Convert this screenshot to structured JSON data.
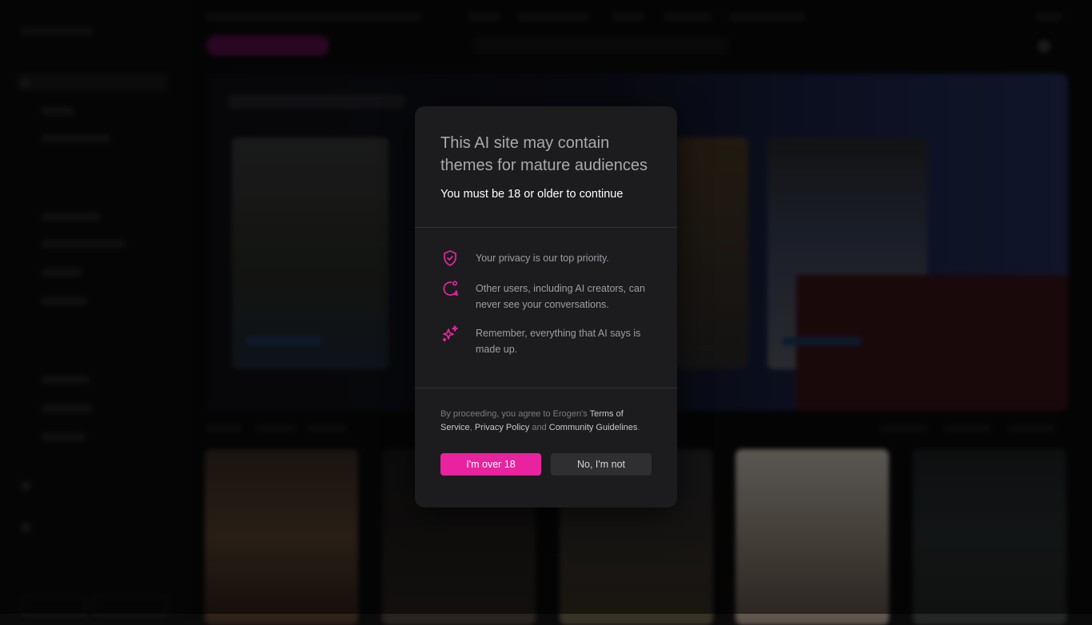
{
  "modal": {
    "title": "This AI site may contain themes for mature audiences",
    "subtitle": "You must be 18 or older to continue",
    "items": [
      {
        "icon": "shield-check-icon",
        "text": "Your privacy is our top priority."
      },
      {
        "icon": "chat-bubble-icon",
        "text": "Other users, including AI creators, can never see your conversations."
      },
      {
        "icon": "sparkles-icon",
        "text": "Remember, everything that AI says is made up."
      }
    ],
    "legal": {
      "prefix": "By proceeding, you agree to Erogen's ",
      "terms": "Terms of Service",
      "sep1": ", ",
      "privacy": "Privacy Policy",
      "sep2": " and ",
      "community": "Community Guidelines",
      "suffix": "."
    },
    "confirm_label": "I'm over 18",
    "decline_label": "No, I'm not"
  },
  "colors": {
    "accent": "#e9239f",
    "modal_bg": "#1c1c1e",
    "page_bg": "#0b0b0c"
  }
}
